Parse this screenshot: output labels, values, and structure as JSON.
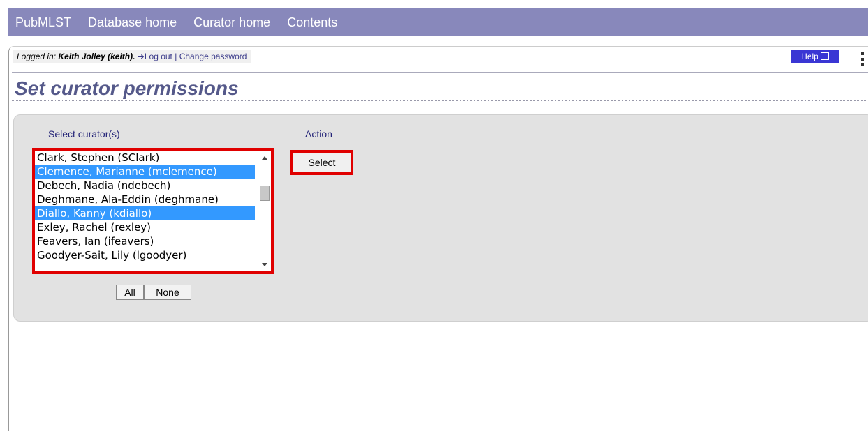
{
  "nav": {
    "items": [
      "PubMLST",
      "Database home",
      "Curator home",
      "Contents"
    ]
  },
  "userbar": {
    "logged_label": "Logged in:",
    "user": "Keith Jolley (keith).",
    "logout": "Log out",
    "separator": "|",
    "change_password": "Change password"
  },
  "help": {
    "label": "Help"
  },
  "page": {
    "title": "Set curator permissions"
  },
  "form": {
    "curators_legend": "Select curator(s)",
    "action_legend": "Action",
    "curators": [
      {
        "label": "Clark, Stephen (SClark)",
        "selected": false
      },
      {
        "label": "Clemence, Marianne (mclemence)",
        "selected": true
      },
      {
        "label": "Debech, Nadia (ndebech)",
        "selected": false
      },
      {
        "label": "Deghmane, Ala-Eddin (deghmane)",
        "selected": false
      },
      {
        "label": "Diallo, Kanny (kdiallo)",
        "selected": true
      },
      {
        "label": "Exley, Rachel (rexley)",
        "selected": false
      },
      {
        "label": "Feavers, Ian (ifeavers)",
        "selected": false
      },
      {
        "label": "Goodyer-Sait, Lily (lgoodyer)",
        "selected": false
      }
    ],
    "all_button": "All",
    "none_button": "None",
    "select_button": "Select"
  },
  "colors": {
    "nav_bg": "#8888bb",
    "title": "#55598a",
    "highlight": "#e00000",
    "selected_item": "#3399ff"
  }
}
